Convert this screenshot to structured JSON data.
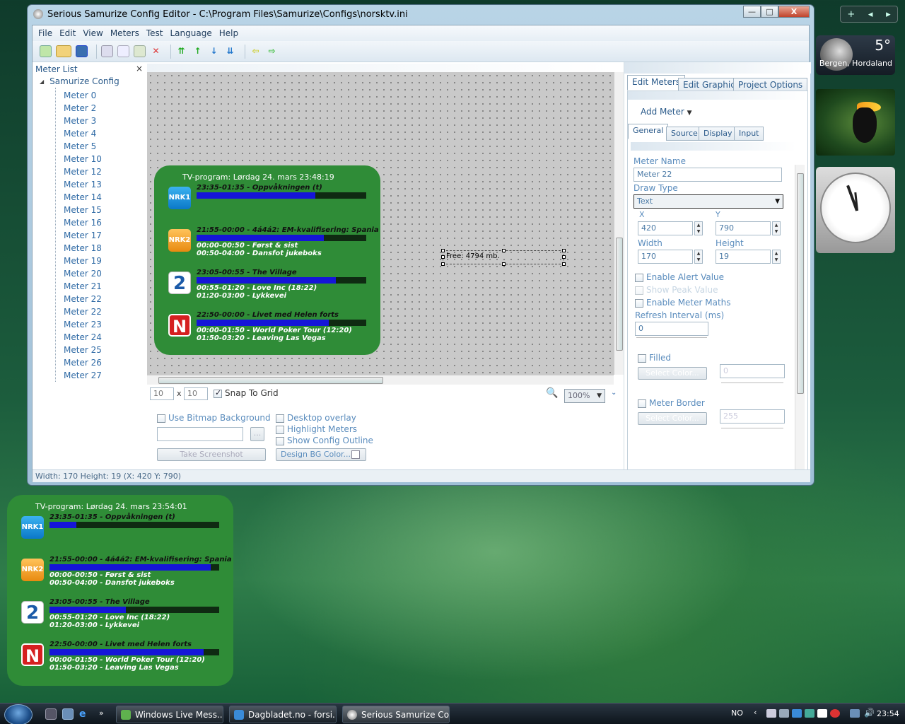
{
  "sidebar": {
    "weather_temp": "5°",
    "weather_location": "Bergen, Hordaland"
  },
  "window": {
    "title": "Serious Samurize Config Editor - C:\\Program Files\\Samurize\\Configs\\norsktv.ini",
    "controls": {
      "minimize": "—",
      "maximize": "□",
      "close": "X"
    }
  },
  "menu": [
    "File",
    "Edit",
    "View",
    "Meters",
    "Test",
    "Language",
    "Help"
  ],
  "meter_list": {
    "title": "Meter List",
    "close": "×",
    "root": "Samurize Config",
    "items": [
      "Meter 0",
      "Meter 2",
      "Meter 3",
      "Meter 4",
      "Meter 5",
      "Meter 10",
      "Meter 12",
      "Meter 13",
      "Meter 14",
      "Meter 15",
      "Meter 16",
      "Meter 17",
      "Meter 18",
      "Meter 19",
      "Meter 20",
      "Meter 21",
      "Meter 22",
      "Meter 22",
      "Meter 23",
      "Meter 24",
      "Meter 25",
      "Meter 26",
      "Meter 27"
    ]
  },
  "tv_editor": {
    "header": "TV-program: Lørdag 24. mars 23:48:19",
    "channels": [
      {
        "logo": "NRK1",
        "program": "23:35-01:35 - Oppvåkningen (t)",
        "progress": 0.7,
        "next": [
          "",
          ""
        ]
      },
      {
        "logo": "NRK2",
        "program": "21:55-00:00 - 4á4á2: EM-kvalifisering: Spania",
        "progress": 0.75,
        "next": [
          "00:00-00:50 - Først & sist",
          "00:50-04:00 - Dansfot jukeboks"
        ]
      },
      {
        "logo": "2",
        "program": "23:05-00:55 - The Village",
        "progress": 0.82,
        "next": [
          "00:55-01:20 - Love Inc (18:22)",
          "01:20-03:00 - Lykkevei"
        ]
      },
      {
        "logo": "N",
        "program": "22:50-00:00 - Livet med Helen forts",
        "progress": 0.78,
        "next": [
          "00:00-01:50 - World Poker Tour (12:20)",
          "01:50-03:20 - Leaving Las Vegas"
        ]
      }
    ]
  },
  "tv_desktop": {
    "header": "TV-program: Lørdag 24. mars 23:54:01",
    "channels": [
      {
        "logo": "NRK1",
        "program": "23:35-01:35 - Oppvåkningen (t)",
        "progress": 0.16,
        "next": [
          "",
          ""
        ]
      },
      {
        "logo": "NRK2",
        "program": "21:55-00:00 - 4á4á2: EM-kvalifisering: Spania",
        "progress": 0.95,
        "next": [
          "00:00-00:50 - Først & sist",
          "00:50-04:00 - Dansfot jukeboks"
        ]
      },
      {
        "logo": "2",
        "program": "23:05-00:55 - The Village",
        "progress": 0.45,
        "next": [
          "00:55-01:20 - Love Inc (18:22)",
          "01:20-03:00 - Lykkevei"
        ]
      },
      {
        "logo": "N",
        "program": "22:50-00:00 - Livet med Helen forts",
        "progress": 0.91,
        "next": [
          "00:00-01:50 - World Poker Tour (12:20)",
          "01:50-03:20 - Leaving Las Vegas"
        ]
      }
    ]
  },
  "selected_meter_text": "Free: 4794 mb.",
  "canvas_controls": {
    "grid_x": "10",
    "x_sep": "x",
    "grid_y": "10",
    "snap_label": "Snap To Grid",
    "zoom": "100%",
    "use_bitmap_bg": "Use Bitmap Background",
    "browse": "...",
    "take_screenshot": "Take Screenshot",
    "desktop_overlay": "Desktop overlay",
    "highlight_meters": "Highlight Meters",
    "show_config_outline": "Show Config Outline",
    "design_bg_color": "Design BG Color..."
  },
  "right_panel": {
    "tabs": [
      "Edit Meters",
      "Edit Graphics",
      "Project Options"
    ],
    "add_meter": "Add Meter",
    "subtabs": [
      "General",
      "Source",
      "Display",
      "Input"
    ],
    "meter_name_label": "Meter Name",
    "meter_name": "Meter 22",
    "draw_type_label": "Draw Type",
    "draw_type": "Text",
    "x_label": "X",
    "x": "420",
    "y_label": "Y",
    "y": "790",
    "width_label": "Width",
    "width": "170",
    "height_label": "Height",
    "height": "19",
    "enable_alert": "Enable Alert Value",
    "show_peak": "Show Peak Value",
    "enable_maths": "Enable Meter Maths",
    "refresh_label": "Refresh Interval (ms)",
    "refresh": "0",
    "filled": "Filled",
    "select_color": "Select Color...",
    "filled_value": "0",
    "meter_border": "Meter Border",
    "border_value": "255"
  },
  "status": "Width: 170  Height: 19  (X: 420  Y: 790)",
  "taskbar": {
    "tasks": [
      "Windows Live Mess...",
      "Dagbladet.no - forsi...",
      "Serious Samurize Co..."
    ],
    "lang": "NO",
    "time": "23:54"
  }
}
